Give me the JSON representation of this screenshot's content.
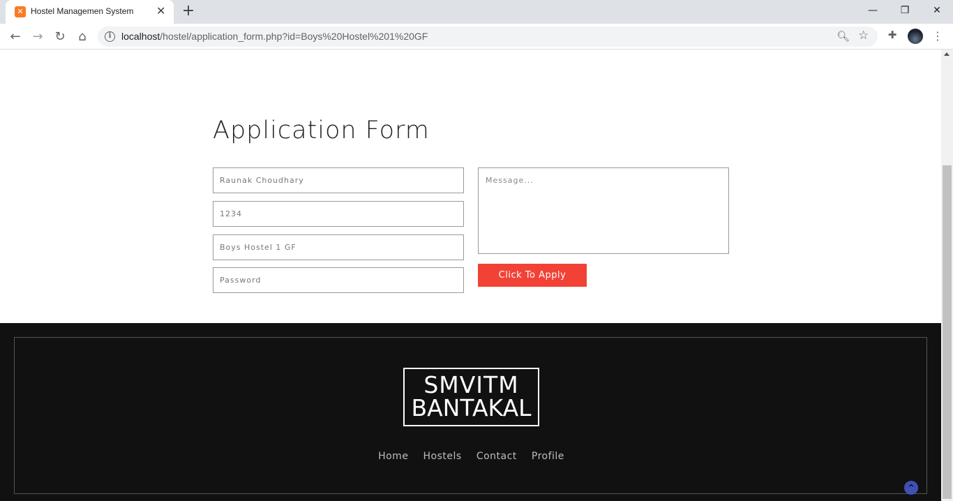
{
  "browser": {
    "tab_title": "Hostel Managemen System",
    "tab_favicon": "xampp-icon",
    "url_host": "localhost",
    "url_path": "/hostel/application_form.php?id=Boys%20Hostel%201%20GF",
    "icons": {
      "back": "back-arrow-icon",
      "forward": "forward-arrow-icon",
      "reload": "reload-icon",
      "home": "home-icon",
      "info": "info-icon",
      "zoom": "zoom-icon",
      "bookmark": "star-icon",
      "extensions": "puzzle-icon",
      "menu": "kebab-menu-icon"
    }
  },
  "form": {
    "title": "Application Form",
    "name_value": "Raunak Choudhary",
    "roll_value": "1234",
    "hostel_value": "Boys Hostel 1 GF",
    "password_placeholder": "Password",
    "message_placeholder": "Message...",
    "submit_label": "Click To Apply",
    "accent_color": "#f24236"
  },
  "footer": {
    "logo_line1": "SMVITM",
    "logo_line2": "BANTAKAL",
    "nav": [
      "Home",
      "Hostels",
      "Contact",
      "Profile"
    ],
    "back_to_top_icon": "chevron-up-icon",
    "background_color": "#111111"
  }
}
